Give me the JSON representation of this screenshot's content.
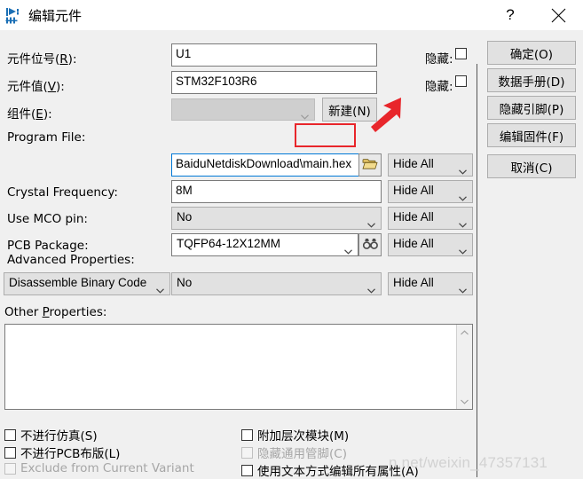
{
  "window": {
    "title": "编辑元件",
    "icon": "component-symbol-icon",
    "help_label": "?",
    "close_label": "✕"
  },
  "form": {
    "rows": [
      {
        "label_prefix": "元件位号(",
        "label_key": "R",
        "label_suffix": "):",
        "value": "U1"
      },
      {
        "label_prefix": "元件值(",
        "label_key": "V",
        "label_suffix": "):",
        "value": "STM32F103R6"
      },
      {
        "label_prefix": "组件(",
        "label_key": "E",
        "label_suffix": "):",
        "value": ""
      }
    ],
    "hidden_label": "隐藏:",
    "hidden_checked": false,
    "new_button": "新建(N)",
    "program_file": {
      "label": "Program File:",
      "value": "BaiduNetdiskDownload\\main.hex",
      "browse_icon": "open-folder-icon"
    },
    "crystal_frequency": {
      "label": "Crystal Frequency:",
      "value": "8M"
    },
    "use_mco_pin": {
      "label": "Use MCO pin:",
      "value": "No"
    },
    "pcb_package": {
      "label": "PCB Package:",
      "value": "TQFP64-12X12MM",
      "search_icon": "binoculars-icon"
    },
    "advanced_properties": {
      "label": "Advanced Properties:",
      "property": "Disassemble Binary Code",
      "value": "No"
    },
    "other_properties": {
      "label_prefix": "Other ",
      "label_key": "P",
      "label_suffix": "roperties:",
      "value": ""
    },
    "hide_all_label": "Hide All",
    "hide_all_count": 4
  },
  "buttons": [
    {
      "label": "确定(O)",
      "name": "ok-button"
    },
    {
      "label": "数据手册(D)",
      "name": "datasheet-button"
    },
    {
      "label": "隐藏引脚(P)",
      "name": "hide-pins-button"
    },
    {
      "label": "编辑固件(F)",
      "name": "edit-firmware-button"
    },
    {
      "label": "取消(C)",
      "name": "cancel-button"
    }
  ],
  "checkboxes_left": [
    {
      "text": "不进行仿真(S)",
      "checked": false,
      "disabled": false,
      "key": "S",
      "name": "exclude-from-simulation"
    },
    {
      "text": "不进行PCB布版(L)",
      "checked": false,
      "disabled": false,
      "key": "L",
      "name": "exclude-from-pcb-layout"
    },
    {
      "text": "Exclude from Current Variant",
      "checked": false,
      "disabled": true,
      "key": "",
      "name": "exclude-from-current-variant"
    }
  ],
  "checkboxes_right": [
    {
      "text": "附加层次模块(M)",
      "checked": false,
      "disabled": false,
      "key": "M",
      "name": "attach-hierarchy-module"
    },
    {
      "text": "隐藏通用管脚(C)",
      "checked": false,
      "disabled": true,
      "key": "C",
      "name": "hide-common-pins"
    },
    {
      "text": "使用文本方式编辑所有属性(A)",
      "checked": false,
      "disabled": false,
      "key": "A",
      "name": "edit-all-properties-as-text"
    }
  ],
  "annotation": {
    "highlight_text": "\\main.hex",
    "arrow_color": "#e8262b",
    "box_color": "#e8262b"
  },
  "watermark": {
    "text": "n.net/weixin_47357131"
  },
  "colors": {
    "window_bg": "#f0f0f0",
    "titlebar_bg": "#ffffff",
    "field_bg": "#ffffff",
    "combo_bg": "#e1e1e1",
    "focus_border": "#0078d7",
    "accent_red": "#e8262b"
  }
}
